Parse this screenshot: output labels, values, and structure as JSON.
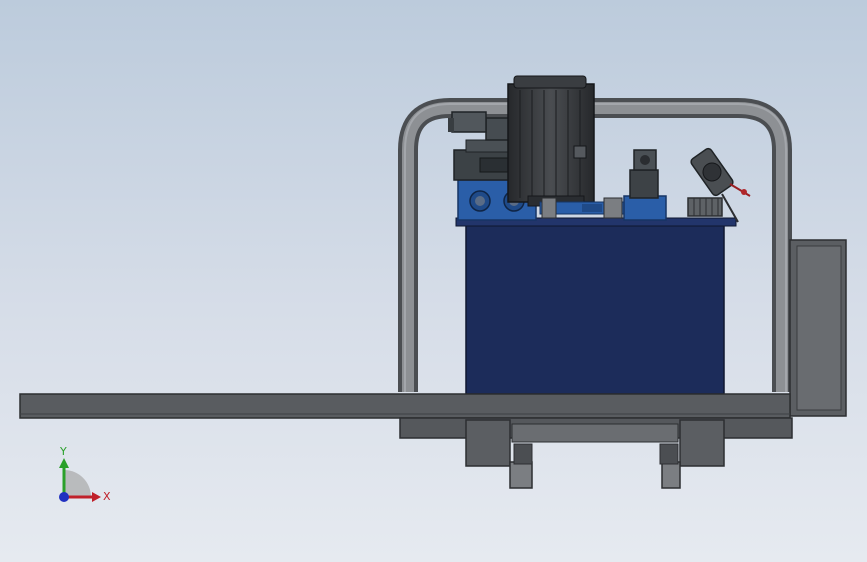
{
  "viewport": {
    "background_top": "#bccbdc",
    "background_bottom": "#e6eaf0"
  },
  "colors": {
    "frame_gray": "#5a5d61",
    "frame_dark": "#3f4246",
    "tank_blue": "#1c2c5a",
    "valve_blue": "#2a5ea8",
    "motor_dark": "#2f3236",
    "pipe_gray": "#7b7e82"
  },
  "triad": {
    "x_label": "X",
    "y_label": "Y",
    "x_color": "#c0202a",
    "y_color": "#2aa02a",
    "z_color": "#2030c0"
  },
  "components": [
    "base-frame-rail",
    "oil-tank",
    "electric-motor",
    "directional-valve-stack",
    "manifold-block",
    "return-pipe-loop",
    "pressure-gauge",
    "filter-element",
    "side-panel"
  ]
}
